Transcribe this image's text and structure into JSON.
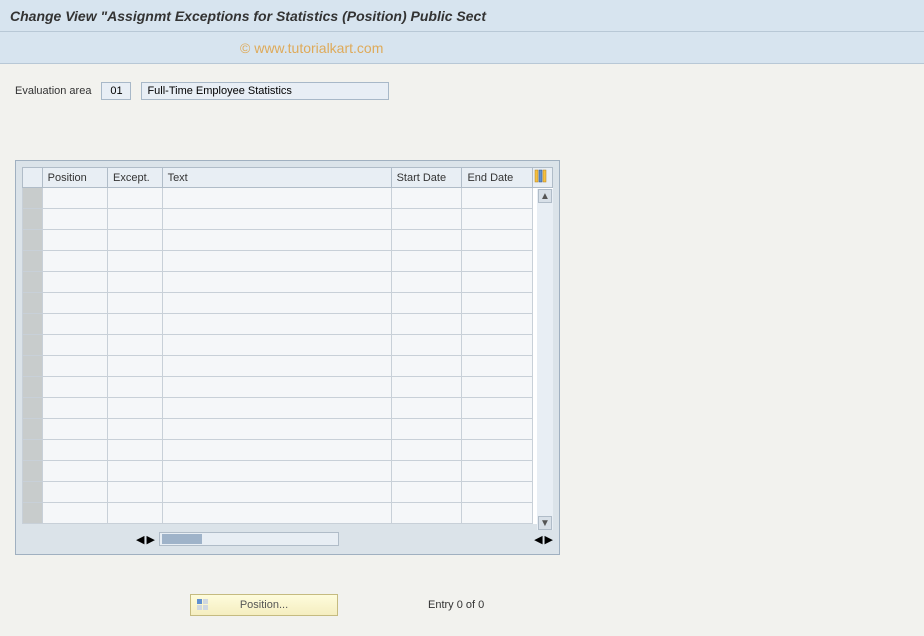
{
  "title": "Change View \"Assignmt Exceptions for Statistics (Position) Public Sect",
  "watermark": "© www.tutorialkart.com",
  "evaluation": {
    "label": "Evaluation area",
    "code": "01",
    "description": "Full-Time Employee Statistics"
  },
  "table": {
    "columns": [
      "Position",
      "Except.",
      "Text",
      "Start Date",
      "End Date"
    ],
    "rowCount": 16
  },
  "footer": {
    "positionButton": "Position...",
    "entryText": "Entry 0 of 0"
  }
}
